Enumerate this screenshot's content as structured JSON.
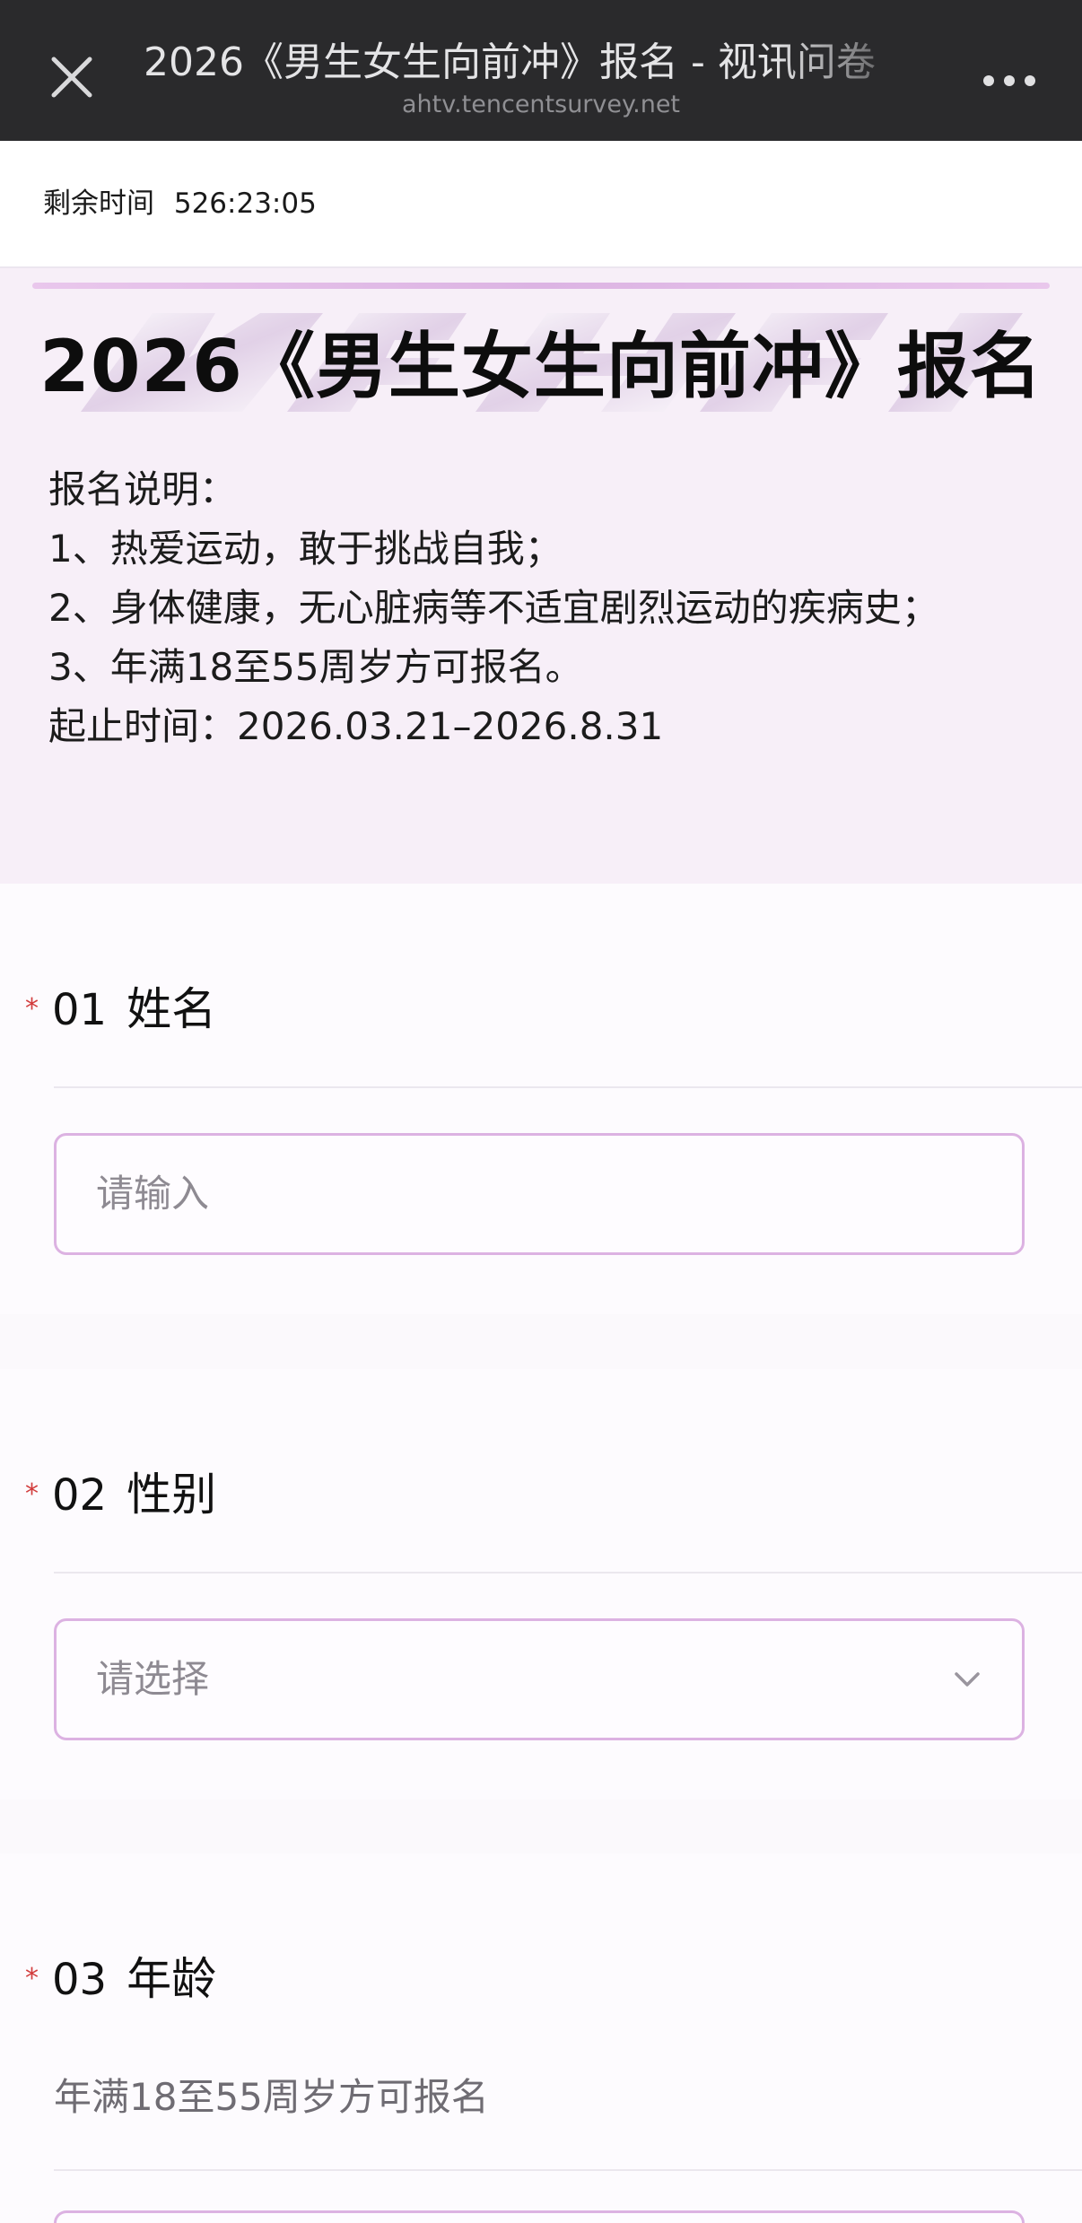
{
  "nav": {
    "title": "2026《男生女生向前冲》报名 - 视讯问卷",
    "domain": "ahtv.tencentsurvey.net",
    "close_icon": "close-icon",
    "more_icon": "more-dots-icon"
  },
  "timer": {
    "label": "剩余时间",
    "value": "526:23:05"
  },
  "header": {
    "title": "2026《男生女生向前冲》报名",
    "description": [
      "报名说明：",
      "1、热爱运动，敢于挑战自我；",
      "2、身体健康，无心脏病等不适宜剧烈运动的疾病史；",
      "3、年满18至55周岁方可报名。",
      "起止时间：2026.03.21–2026.8.31"
    ]
  },
  "questions": [
    {
      "required_mark": "*",
      "number": "01",
      "label": "姓名",
      "type": "text",
      "placeholder": "请输入"
    },
    {
      "required_mark": "*",
      "number": "02",
      "label": "性别",
      "type": "select",
      "placeholder": "请选择",
      "icon": "chevron-down-icon"
    },
    {
      "required_mark": "*",
      "number": "03",
      "label": "年龄",
      "type": "text",
      "hint": "年满18至55周岁方可报名"
    }
  ],
  "colors": {
    "navbar": "#2a2a2c",
    "header_bg": "#f7eff8",
    "accent_border": "#dcb2e2",
    "required": "#d23c3c"
  }
}
